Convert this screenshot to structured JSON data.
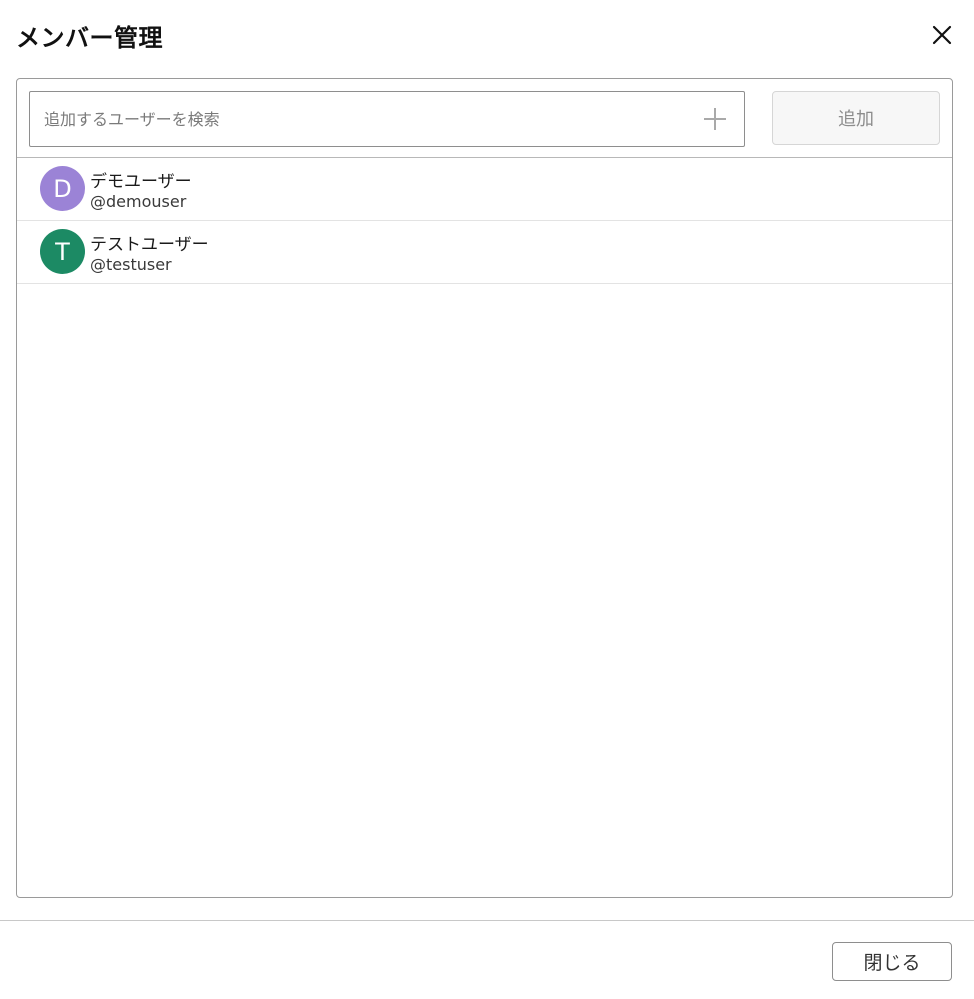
{
  "dialog": {
    "title": "メンバー管理",
    "close_icon": "close-icon"
  },
  "search": {
    "placeholder": "追加するユーザーを検索",
    "value": "",
    "plus_icon": "plus-icon",
    "add_label": "追加"
  },
  "members": [
    {
      "initial": "D",
      "name": "デモユーザー",
      "handle": "@demouser",
      "avatar_color": "#9b83d6"
    },
    {
      "initial": "T",
      "name": "テストユーザー",
      "handle": "@testuser",
      "avatar_color": "#1c8a64"
    }
  ],
  "footer": {
    "close_label": "閉じる"
  }
}
